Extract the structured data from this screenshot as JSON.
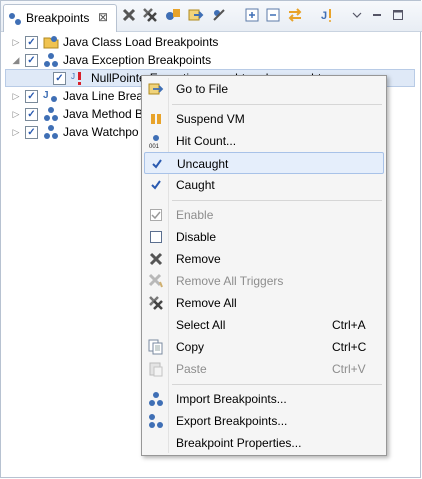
{
  "tab": {
    "label": "Breakpoints",
    "close": "⊠"
  },
  "toolbar": {
    "buttons": [
      "remove-icon",
      "remove-all-icon",
      "skip-icon",
      "link-icon",
      "filter-icon",
      "expand-all-icon",
      "collapse-all-icon",
      "swap-icon",
      "j-breakpoint-icon",
      "view-menu-icon",
      "minimize-icon",
      "maximize-icon"
    ]
  },
  "tree": {
    "items": [
      {
        "label": "Java Class Load Breakpoints",
        "expanded": false,
        "checked": true
      },
      {
        "label": "Java Exception Breakpoints",
        "expanded": true,
        "checked": true
      },
      {
        "label": "NullPointerException: caught and uncaught",
        "checked": true
      },
      {
        "label": "Java Line Breakpoints",
        "visible": "Java Line Brea",
        "expanded": false,
        "checked": true
      },
      {
        "label": "Java Method Breakpoints",
        "visible": "Java Method B",
        "expanded": false,
        "checked": true
      },
      {
        "label": "Java Watchpoints",
        "visible": "Java Watchpo",
        "expanded": false,
        "checked": true
      }
    ]
  },
  "menu": {
    "items": [
      {
        "label": "Go to File"
      },
      {
        "label": "Suspend VM"
      },
      {
        "label": "Hit Count..."
      },
      {
        "label": "Uncaught",
        "checked": true
      },
      {
        "label": "Caught",
        "checked": true
      },
      {
        "label": "Enable",
        "disabled": true
      },
      {
        "label": "Disable"
      },
      {
        "label": "Remove"
      },
      {
        "label": "Remove All Triggers",
        "disabled": true
      },
      {
        "label": "Remove All"
      },
      {
        "label": "Select All",
        "shortcut": "Ctrl+A"
      },
      {
        "label": "Copy",
        "shortcut": "Ctrl+C"
      },
      {
        "label": "Paste",
        "shortcut": "Ctrl+V",
        "disabled": true
      },
      {
        "label": "Import Breakpoints..."
      },
      {
        "label": "Export Breakpoints..."
      },
      {
        "label": "Breakpoint Properties..."
      }
    ]
  },
  "colors": {
    "accent": "#2a5ab0",
    "selection": "#dfe9f7",
    "menu_bg": "#f5f5f5"
  }
}
